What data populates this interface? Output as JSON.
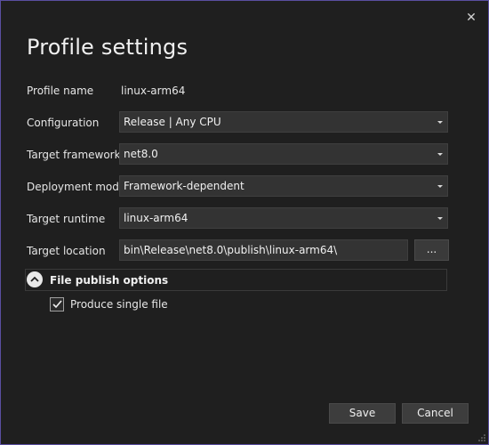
{
  "dialog": {
    "title": "Profile settings",
    "close_glyph": "✕"
  },
  "fields": {
    "profile_name": {
      "label": "Profile name",
      "value": "linux-arm64"
    },
    "configuration": {
      "label": "Configuration",
      "value": "Release | Any CPU"
    },
    "target_framework": {
      "label": "Target framework",
      "value": "net8.0"
    },
    "deployment_mode": {
      "label": "Deployment mode",
      "value": "Framework-dependent"
    },
    "target_runtime": {
      "label": "Target runtime",
      "value": "linux-arm64"
    },
    "target_location": {
      "label": "Target location",
      "value": "bin\\Release\\net8.0\\publish\\linux-arm64\\",
      "browse_label": "..."
    }
  },
  "file_publish_options": {
    "label": "File publish options",
    "expanded": true,
    "produce_single_file": {
      "label": "Produce single file",
      "checked": true
    }
  },
  "buttons": {
    "save": "Save",
    "cancel": "Cancel"
  },
  "icons": {
    "close": "close-icon",
    "expander": "chevron-up-icon",
    "dropdown": "chevron-down-icon",
    "checkbox": "checkmark-icon",
    "resize": "resize-grip-icon"
  },
  "colors": {
    "background": "#1f1f1f",
    "border_accent": "#5a4fa0",
    "input_background": "#333333",
    "button_background": "#3d3d3d"
  }
}
